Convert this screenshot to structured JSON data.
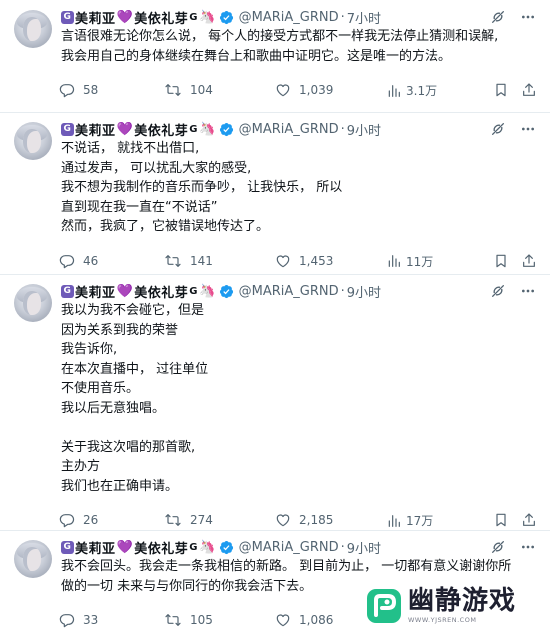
{
  "author": {
    "g_badge": "G",
    "name_part1": "美莉亚",
    "heart_icon": "💜",
    "name_part2": "美依礼芽",
    "g_suffix": "G",
    "unicorn_icon": "🦄",
    "verified_icon": "verified-badge",
    "handle": "@MARiA_GRND",
    "dot": "·"
  },
  "colors": {
    "text": "#0f1419",
    "muted": "#536471",
    "verified": "#1d9bf0",
    "divider": "#e6ecf0",
    "heart": "#a56ad8",
    "badge": "#6e5ab8",
    "watermark_green": "#22c08a"
  },
  "tweets": [
    {
      "time": "7小时",
      "lines": [
        "言语很难无论你怎么说，  每个人的接受方式都不一样我无法停止猜测和误解,",
        "我会用自己的身体继续在舞台上和歌曲中证明它。这是唯一的方法。"
      ],
      "replies": "58",
      "retweets": "104",
      "likes": "1,039",
      "views": "3.1万"
    },
    {
      "time": "9小时",
      "lines": [
        "不说话，  就找不出借口,",
        "通过发声，  可以扰乱大家的感受,",
        "我不想为我制作的音乐而争吵，  让我快乐，  所以",
        "直到现在我一直在“不说话”",
        "然而，我疯了，它被错误地传达了。"
      ],
      "replies": "46",
      "retweets": "141",
      "likes": "1,453",
      "views": "11万"
    },
    {
      "time": "9小时",
      "lines": [
        "我以为我不会碰它，但是",
        "因为关系到我的荣誉",
        "我告诉你,",
        "在本次直播中，  过往单位",
        "不使用音乐。",
        "我以后无意独唱。",
        "",
        "关于我这次唱的那首歌,",
        "主办方",
        "我们也在正确申请。"
      ],
      "replies": "26",
      "retweets": "274",
      "likes": "2,185",
      "views": "17万"
    },
    {
      "time": "9小时",
      "lines": [
        "我不会回头。我会走一条我相信的新路。  到目前为止，  一切都有意义谢谢你所",
        "做的一切  未来与与你同行的你我会活下去。"
      ],
      "replies": "33",
      "retweets": "105",
      "likes": "1,086",
      "views": ""
    }
  ],
  "icons": {
    "grok": "grok-icon",
    "more": "more-icon",
    "reply": "reply-icon",
    "retweet": "retweet-icon",
    "like": "heart-icon",
    "views": "views-icon",
    "bookmark": "bookmark-icon",
    "share": "share-icon"
  },
  "watermark": {
    "title": "幽静游戏",
    "subtitle": "WWW.YJSREN.COM"
  }
}
